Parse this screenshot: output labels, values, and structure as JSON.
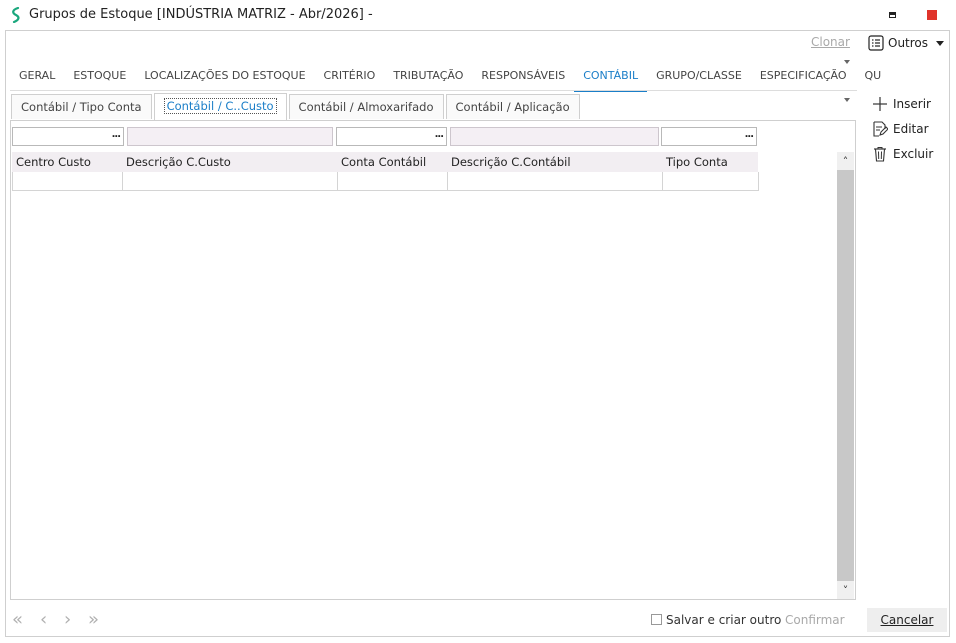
{
  "window": {
    "title": "Grupos de Estoque [INDÚSTRIA MATRIZ - Abr/2026]  -",
    "logo_color": "#1aa77d"
  },
  "toolbar": {
    "clonar_label": "Clonar",
    "outros_label": "Outros"
  },
  "main_tabs": [
    {
      "label": "GERAL"
    },
    {
      "label": "ESTOQUE"
    },
    {
      "label": "LOCALIZAÇÕES DO ESTOQUE"
    },
    {
      "label": "CRITÉRIO"
    },
    {
      "label": "TRIBUTAÇÃO"
    },
    {
      "label": "RESPONSÁVEIS"
    },
    {
      "label": "CONTÁBIL",
      "active": true
    },
    {
      "label": "GRUPO/CLASSE"
    },
    {
      "label": "ESPECIFICAÇÃO"
    },
    {
      "label": "QU"
    }
  ],
  "sub_tabs": [
    {
      "label": "Contábil / Tipo Conta"
    },
    {
      "label": "Contábil / C..Custo",
      "active": true
    },
    {
      "label": "Contábil / Almoxarifado"
    },
    {
      "label": "Contábil / Aplicação"
    }
  ],
  "grid": {
    "columns": [
      "Centro Custo",
      "Descrição C.Custo",
      "Conta Contábil",
      "Descrição C.Contábil",
      "Tipo Conta"
    ],
    "lookup_button_label": "..."
  },
  "actions": {
    "inserir_label": "Inserir",
    "editar_label": "Editar",
    "excluir_label": "Excluir"
  },
  "footer": {
    "salvar_label": "Salvar e criar outro",
    "confirmar_label": "Confirmar",
    "cancelar_label": "Cancelar"
  },
  "colors": {
    "accent": "#1a7ec8",
    "close": "#e0342b",
    "disabled_text": "#a9a9a9"
  }
}
